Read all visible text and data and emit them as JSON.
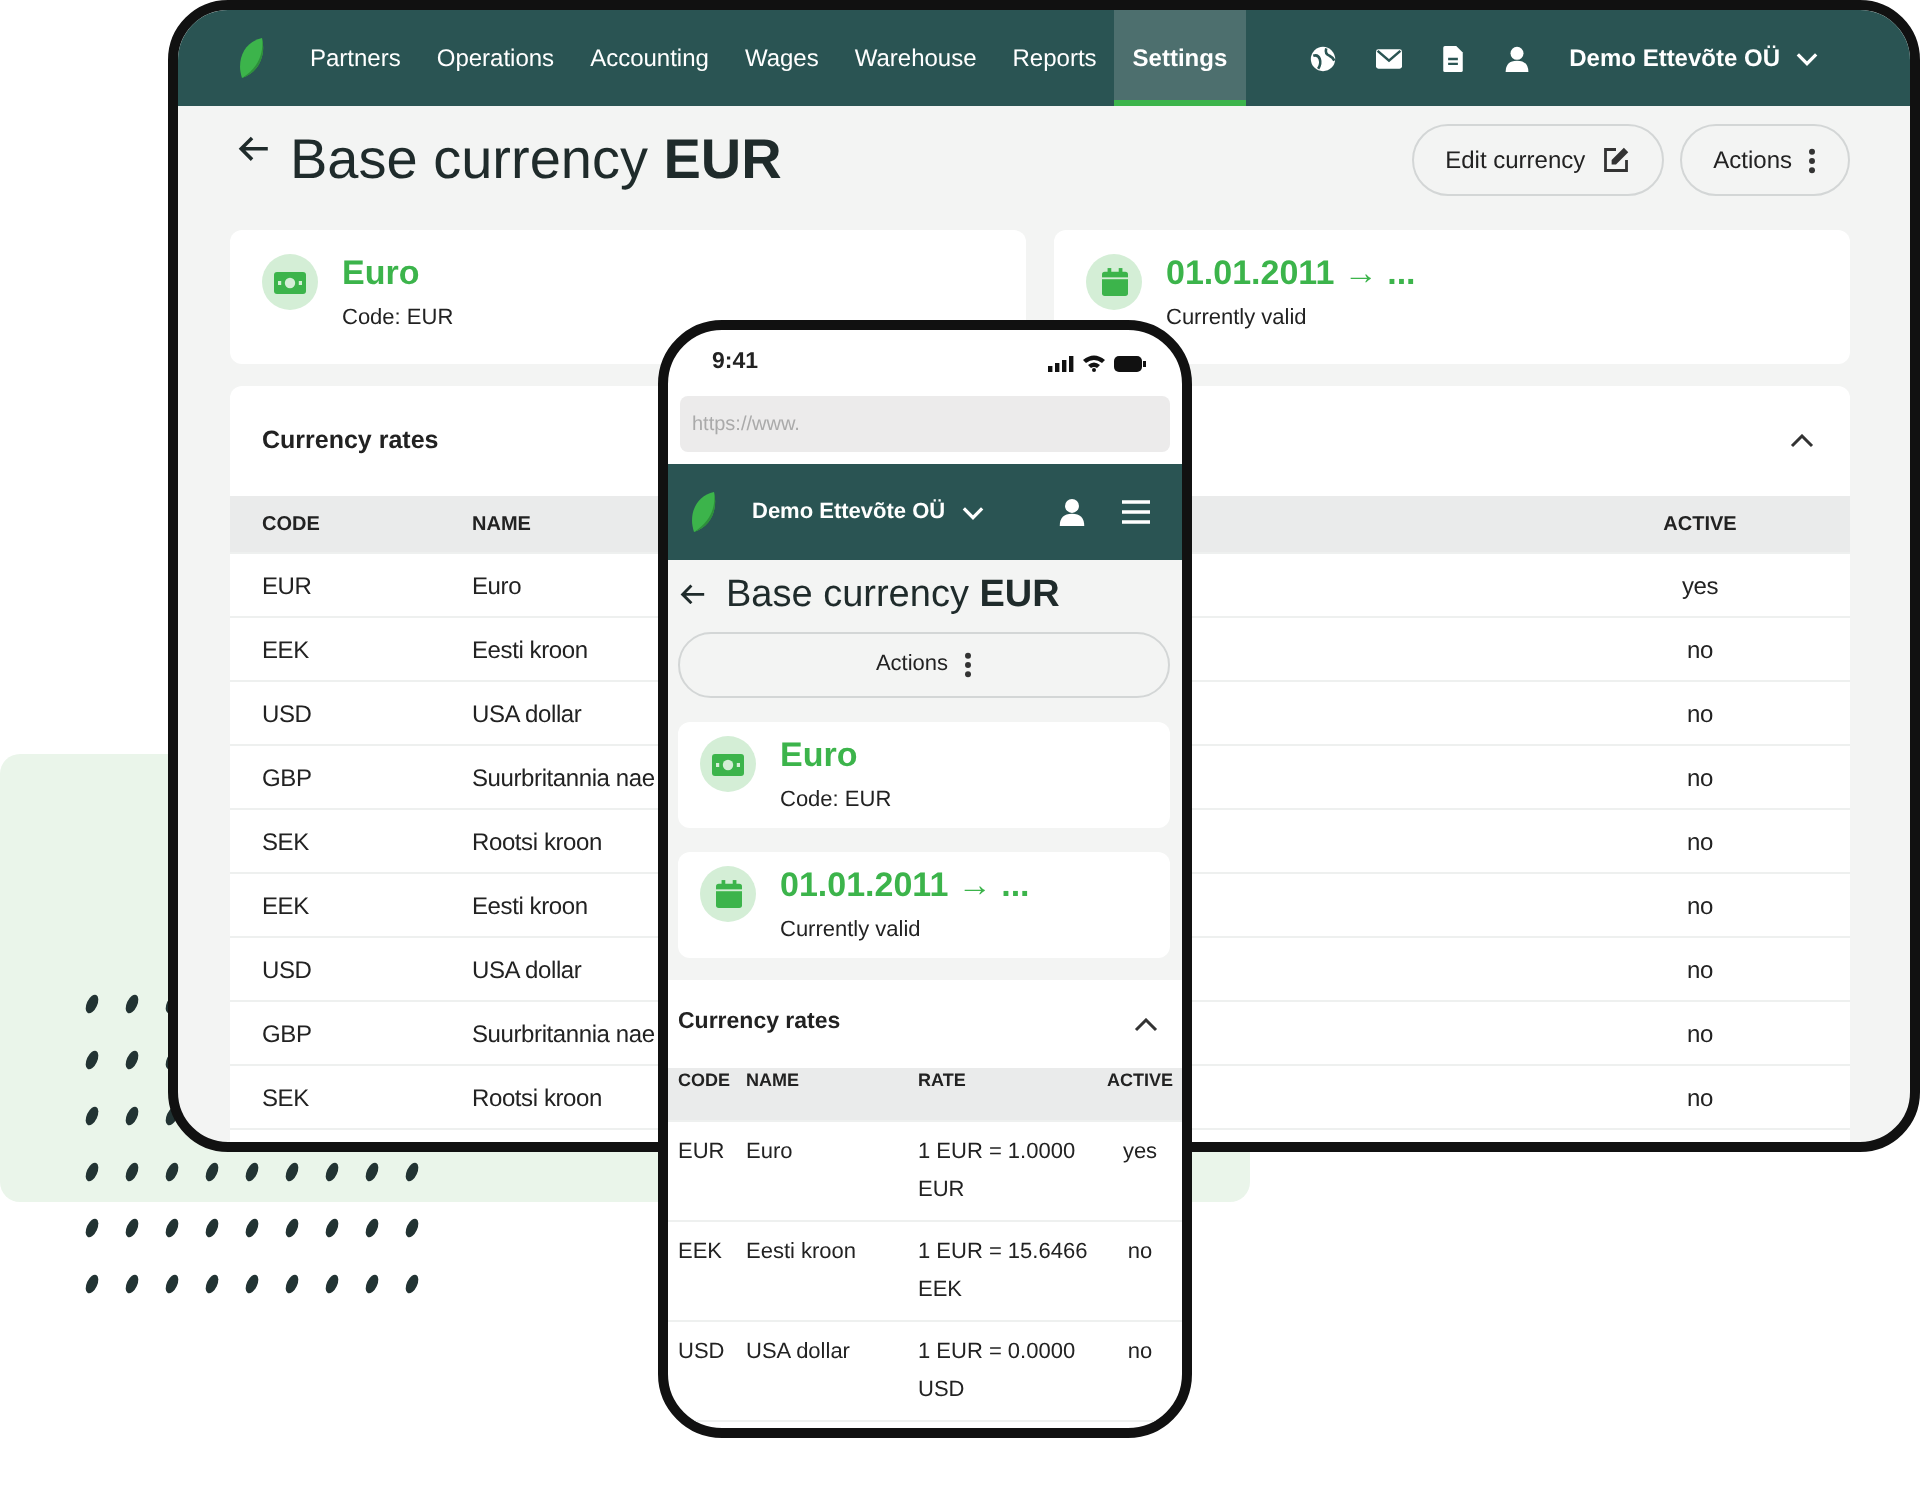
{
  "tablet": {
    "nav": {
      "items": [
        {
          "label": "Partners",
          "selected": false
        },
        {
          "label": "Operations",
          "selected": false
        },
        {
          "label": "Accounting",
          "selected": false
        },
        {
          "label": "Wages",
          "selected": false
        },
        {
          "label": "Warehouse",
          "selected": false
        },
        {
          "label": "Reports",
          "selected": false
        },
        {
          "label": "Settings",
          "selected": true
        }
      ],
      "company": "Demo Ettevõte OÜ"
    },
    "page_title": "Base currency **EUR**",
    "buttons": [
      {
        "label": "Edit currency",
        "kind": "edit"
      },
      {
        "label": "Actions",
        "kind": "more"
      }
    ],
    "currency_card": {
      "title": "Euro",
      "subtitle": "Code: EUR"
    },
    "validity_card": {
      "title": "01.01.2011 → ...",
      "subtitle": "Currently valid"
    },
    "rates": {
      "title": "Currency rates",
      "expanded": true,
      "columns": [
        "CODE",
        "NAME",
        "ACTIVE"
      ],
      "rows": [
        {
          "code": "EUR",
          "name": "Euro",
          "active": "yes"
        },
        {
          "code": "EEK",
          "name": "Eesti kroon",
          "active": "no"
        },
        {
          "code": "USD",
          "name": "USA dollar",
          "active": "no"
        },
        {
          "code": "GBP",
          "name": "Suurbritannia nae",
          "active": "no"
        },
        {
          "code": "SEK",
          "name": "Rootsi kroon",
          "active": "no"
        },
        {
          "code": "EEK",
          "name": "Eesti kroon",
          "active": "no"
        },
        {
          "code": "USD",
          "name": "USA dollar",
          "active": "no"
        },
        {
          "code": "GBP",
          "name": "Suurbritannia nae",
          "active": "no"
        },
        {
          "code": "SEK",
          "name": "Rootsi kroon",
          "active": "no"
        }
      ]
    }
  },
  "phone": {
    "time": "9:41",
    "url": {
      "placeholder": "https://www."
    },
    "company": "Demo Ettevõte OÜ",
    "page_title": "Base currency **EUR**",
    "buttons": [
      {
        "label": "Actions",
        "kind": "more"
      }
    ],
    "currency_card": {
      "title": "Euro",
      "subtitle": "Code: EUR"
    },
    "validity_card": {
      "title": "01.01.2011 → ...",
      "subtitle": "Currently valid"
    },
    "rates": {
      "title": "Currency rates",
      "expanded": true,
      "columns": [
        "CODE",
        "NAME",
        "RATE",
        "ACTIVE"
      ],
      "rows": [
        {
          "code": "EUR",
          "name": "Euro",
          "rate": "1 EUR = 1.0000 EUR",
          "active": "yes"
        },
        {
          "code": "EEK",
          "name": "Eesti kroon",
          "rate": "1 EUR = 15.6466 EEK",
          "active": "no"
        },
        {
          "code": "USD",
          "name": "USA dollar",
          "rate": "1 EUR = 0.0000 USD",
          "active": "no"
        }
      ]
    }
  }
}
